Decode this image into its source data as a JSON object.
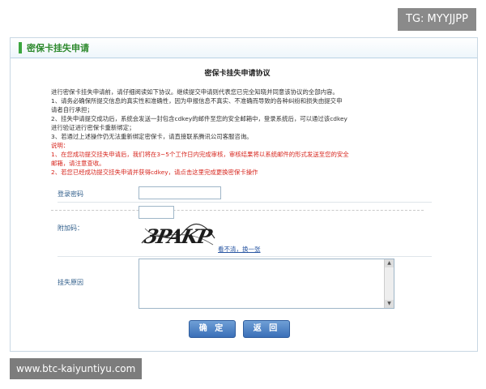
{
  "watermarks": {
    "top_right": "TG: MYYJJPP",
    "bottom_left": "www.btc-kaiyuntiyu.com"
  },
  "header": {
    "title": "密保卡挂失申请"
  },
  "agreement": {
    "title": "密保卡挂失申请协议",
    "lines": [
      "进行密保卡挂失申请前，请仔细阅读如下协议。继续提交申请则代表您已完全知晓并同意该协议的全部内容。",
      "1、请务必确保所提交信息的真实性和准确性，因为申报信息不真实、不准确而导致的各种纠纷和损失由提交申",
      "请者自行承担；",
      "2、挂失申请提交成功后，系统会发送一封包含cdkey的邮件至您的安全邮箱中，登录系统后，可以通过该cdkey",
      "进行验证进行密保卡重新绑定；",
      "3、若通过上述操作仍无法重新绑定密保卡，请直接联系腾讯公司客服咨询。"
    ],
    "notice_lines": [
      "说明：",
      "1、在您成功提交挂失申请后，我们将在3~5个工作日内完成审核，审核结果将以系统邮件的形式发送至您的安全",
      "邮箱，请注意查收。",
      "2、若您已经成功提交挂失申请并获得cdkey，请点击这里完成更换密保卡操作"
    ]
  },
  "form": {
    "password_label": "登录密码",
    "password_value": "",
    "code_label": "附加码：",
    "code_value": "",
    "captcha_text": "3PAKP",
    "refresh_link": "看不清，换一张",
    "reason_label": "挂失原因",
    "reason_value": ""
  },
  "buttons": {
    "confirm": "确 定",
    "back": "返 回"
  },
  "colors": {
    "accent_green": "#2e8a2e",
    "notice_red": "#d7261e",
    "button_blue": "#3a6fb8",
    "label_blue": "#2f5d8a"
  }
}
